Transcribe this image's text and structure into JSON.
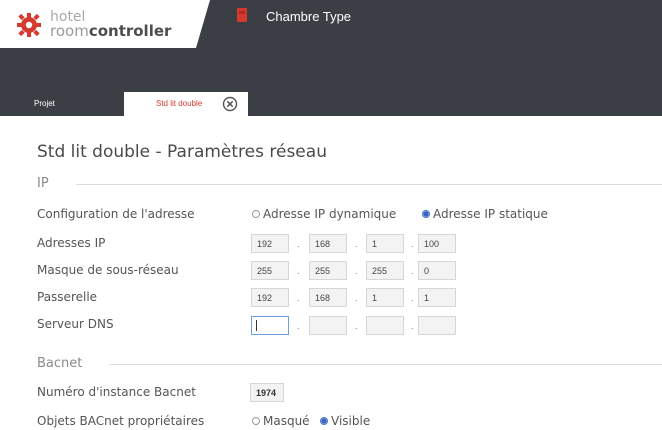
{
  "app": {
    "logo_line1": "hotel",
    "logo_line2_prefix": "room",
    "logo_line2_bold": "controller",
    "window_title": "Chambre Type"
  },
  "tabs": [
    {
      "label": "Projet",
      "active": false
    },
    {
      "label": "Std lit double",
      "active": true
    }
  ],
  "page": {
    "title": "Std lit double - Paramètres réseau"
  },
  "ip_section": {
    "heading": "IP",
    "config_label": "Configuration de l'adresse",
    "option_dynamic": "Adresse IP dynamique",
    "option_static": "Adresse IP statique",
    "selected": "static",
    "rows": [
      {
        "label": "Adresses IP",
        "octets": [
          "192",
          "168",
          "1",
          "100"
        ]
      },
      {
        "label": "Masque de sous-réseau",
        "octets": [
          "255",
          "255",
          "255",
          "0"
        ]
      },
      {
        "label": "Passerelle",
        "octets": [
          "192",
          "168",
          "1",
          "1"
        ]
      },
      {
        "label": "Serveur DNS",
        "octets": [
          "",
          "",
          "",
          ""
        ]
      }
    ],
    "separator": "."
  },
  "bacnet_section": {
    "heading": "Bacnet",
    "instance_label": "Numéro d'instance Bacnet",
    "instance_value": "1974",
    "objects_label": "Objets BACnet propriétaires",
    "option_hidden": "Masqué",
    "option_visible": "Visible",
    "selected": "visible"
  },
  "colors": {
    "header_bg": "#3b3f45",
    "accent_red": "#d43b2e",
    "radio_blue": "#3a66c0"
  }
}
